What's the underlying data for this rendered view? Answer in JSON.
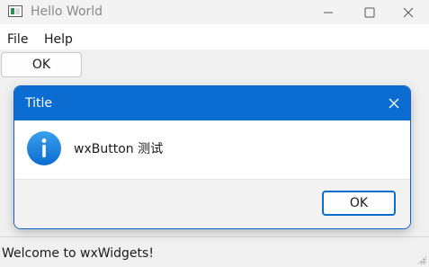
{
  "window": {
    "title": "Hello World",
    "icon": "app-icon",
    "controls": [
      "minimize-icon",
      "maximize-icon",
      "close-icon"
    ]
  },
  "menubar": {
    "items": [
      {
        "label": "File"
      },
      {
        "label": "Help"
      }
    ]
  },
  "main": {
    "ok_label": "OK"
  },
  "statusbar": {
    "text": "Welcome to wxWidgets!"
  },
  "dialog": {
    "title": "Title",
    "icon": "info-icon",
    "message": "wxButton 测试",
    "ok_label": "OK",
    "accent_color": "#0b6cd1"
  }
}
